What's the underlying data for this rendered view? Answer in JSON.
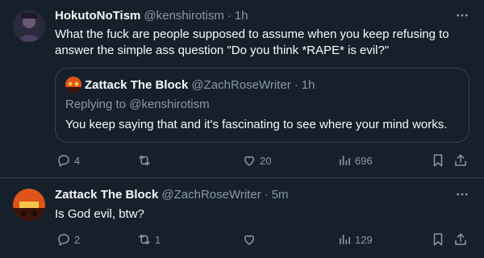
{
  "tweets": [
    {
      "author": {
        "name": "HokutoNoTism",
        "handle": "@kenshirotism",
        "time": "1h"
      },
      "text": "What the fuck are people supposed to assume when you keep refusing to answer the simple ass question \"Do you think *RAPE* is evil?\"",
      "quote": {
        "author": {
          "name": "Zattack The Block",
          "handle": "@ZachRoseWriter",
          "time": "1h"
        },
        "replying_prefix": "Replying to",
        "replying_to": "@kenshirotism",
        "text": "You keep saying that and it's fascinating to see where your mind works."
      },
      "metrics": {
        "replies": "4",
        "retweets": "",
        "likes": "20",
        "views": "696"
      }
    },
    {
      "author": {
        "name": "Zattack The Block",
        "handle": "@ZachRoseWriter",
        "time": "5m"
      },
      "text": "Is God evil, btw?",
      "metrics": {
        "replies": "2",
        "retweets": "1",
        "likes": "",
        "views": "129"
      }
    }
  ],
  "separator": "·",
  "icons": {
    "more": "more-icon",
    "reply": "reply-icon",
    "retweet": "retweet-icon",
    "like": "heart-icon",
    "views": "views-icon",
    "bookmark": "bookmark-icon",
    "share": "share-icon"
  },
  "colors": {
    "background": "#15202b",
    "text": "#f7f9f9",
    "muted": "#8b98a5",
    "border": "#38444d"
  }
}
